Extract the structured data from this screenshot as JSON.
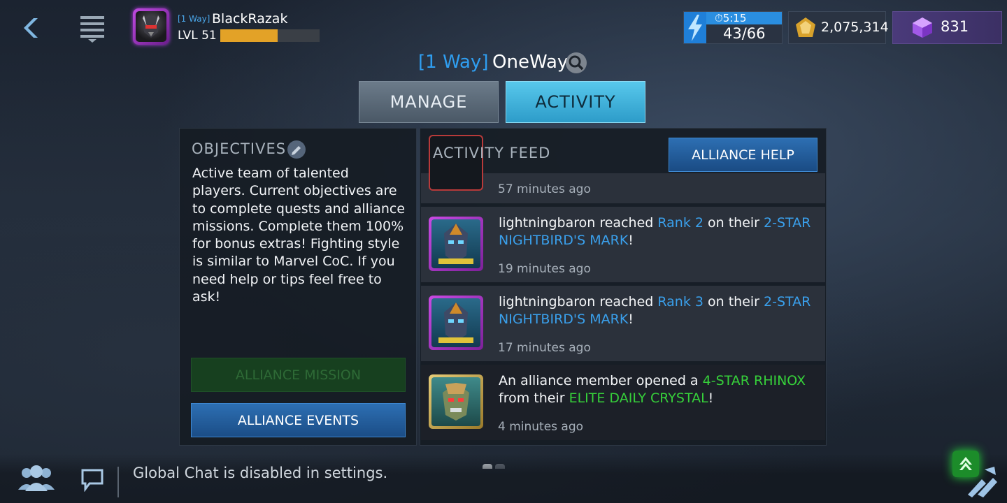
{
  "player": {
    "alliance_tag": "[1 Way]",
    "name": "BlackRazak",
    "level": "LVL 51",
    "xp_fraction": 0.58
  },
  "currency": {
    "energy_timer": "5:15",
    "energy_count": "43/66",
    "credits": "2,075,314",
    "shards": "831"
  },
  "alliance": {
    "tag": "[1 Way]",
    "name": "OneWay"
  },
  "tabs": [
    {
      "label": "MANAGE",
      "active": false
    },
    {
      "label": "ACTIVITY",
      "active": true
    }
  ],
  "objectives": {
    "title": "OBJECTIVES",
    "text": "Active team of talented players. Current objectives are to complete quests and alliance missions. Complete them 100% for bonus extras! Fighting style is similar to Marvel CoC. If you need help or tips feel free to ask!"
  },
  "buttons": {
    "mission": "ALLIANCE MISSION",
    "events": "ALLIANCE EVENTS",
    "help": "ALLIANCE HELP"
  },
  "feed": {
    "title": "ACTIVITY FEED",
    "items": [
      {
        "time": "57 minutes ago"
      },
      {
        "user": "lightningbaron",
        "verb": " reached ",
        "highlight": "Rank 2",
        "mid": " on their ",
        "item": "2-STAR NIGHTBIRD'S MARK",
        "end": "!",
        "time": "19 minutes ago"
      },
      {
        "user": "lightningbaron",
        "verb": " reached ",
        "highlight": "Rank 3",
        "mid": " on their ",
        "item": "2-STAR NIGHTBIRD'S MARK",
        "end": "!",
        "time": "17 minutes ago"
      },
      {
        "prefix": "An alliance member opened a ",
        "item": "4-STAR RHINOX",
        "mid": " from their ",
        "source": "ELITE DAILY CRYSTAL",
        "end": "!",
        "time": "4 minutes ago"
      }
    ]
  },
  "chat": {
    "status": "Global Chat is disabled in settings."
  },
  "colors": {
    "accent_blue": "#2f9ef0",
    "highlight_green": "#36d03a",
    "xp_gold": "#e3a227",
    "tab_active": "#3fb4de"
  },
  "icons": [
    "back-icon",
    "menu-icon",
    "search-icon",
    "edit-icon",
    "energy-bolt-icon",
    "credits-icon",
    "shards-icon",
    "members-icon",
    "chat-icon",
    "rank-badge-icon",
    "quick-actions-icon"
  ]
}
